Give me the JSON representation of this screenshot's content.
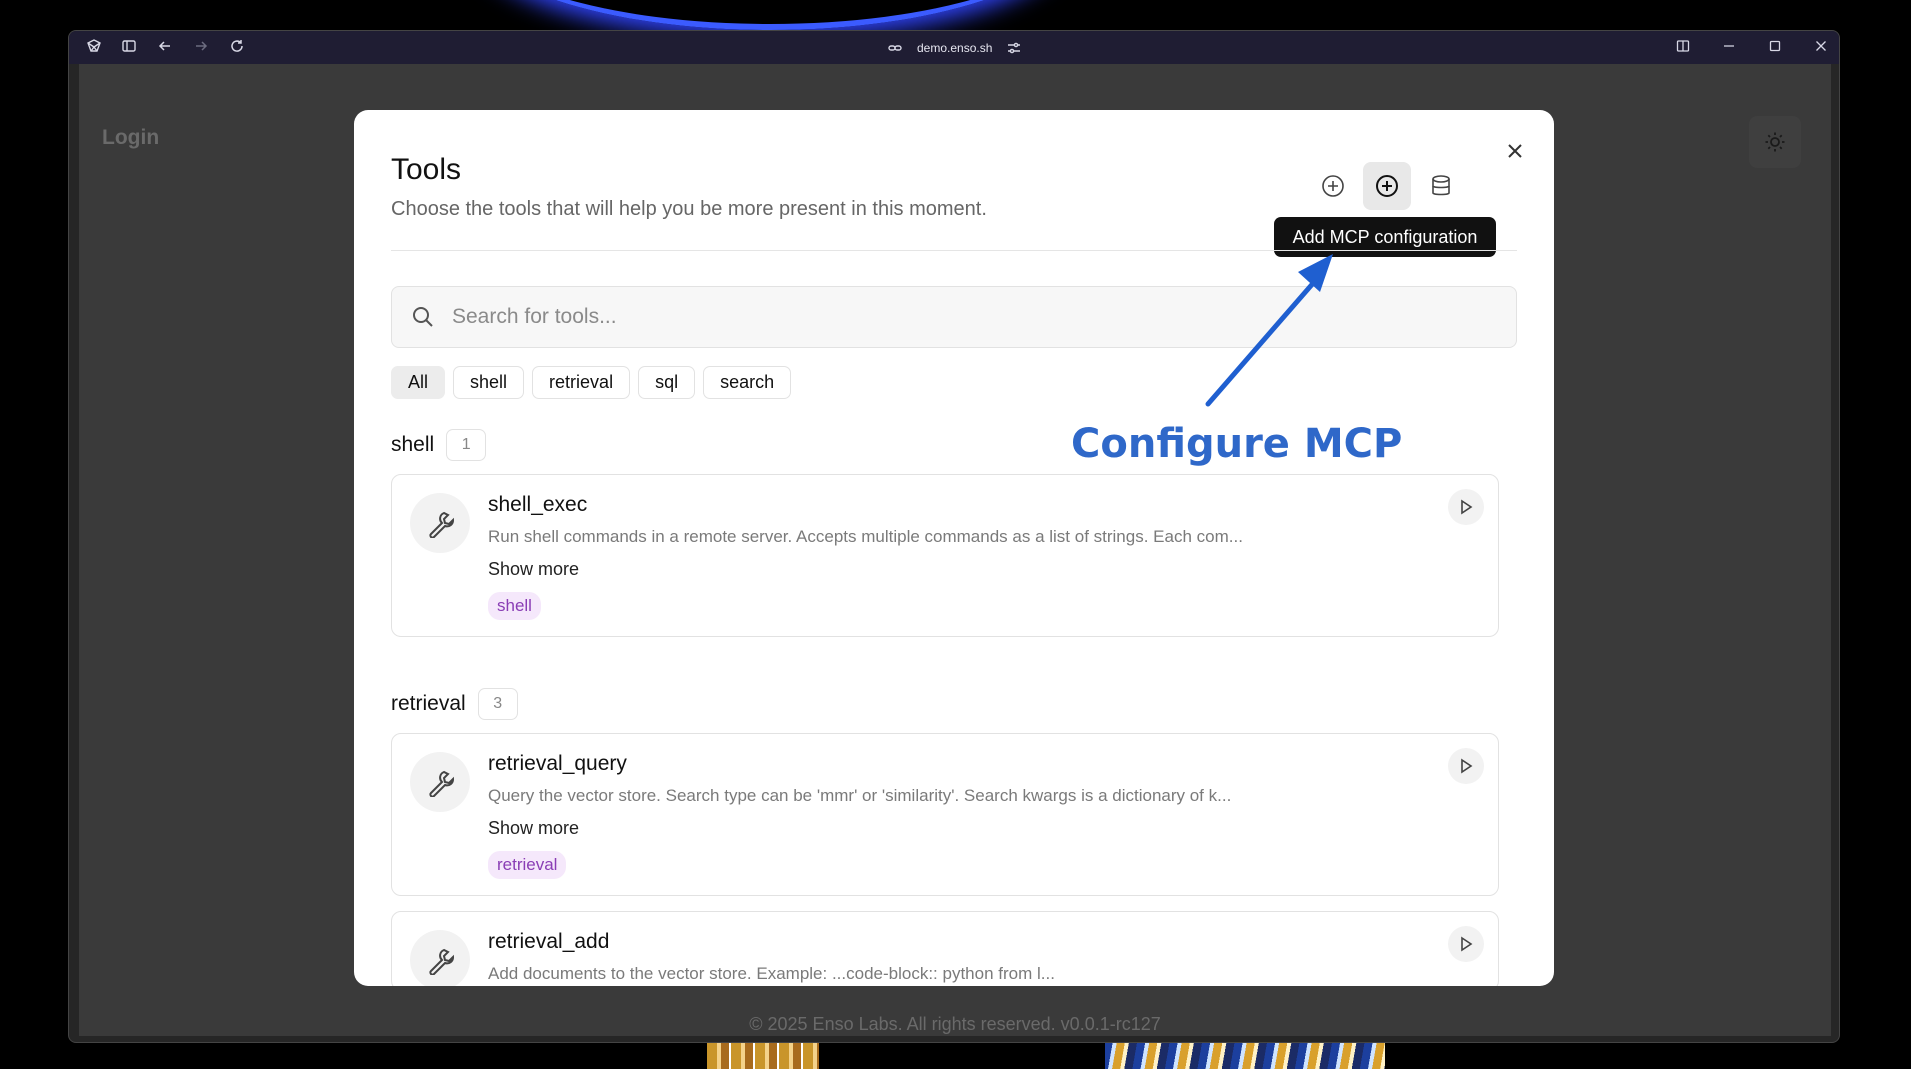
{
  "browser": {
    "url": "demo.enso.sh"
  },
  "app": {
    "login_label": "Login",
    "footer": "© 2025 Enso Labs. All rights reserved. v0.0.1-rc127"
  },
  "modal": {
    "title": "Tools",
    "subtitle": "Choose the tools that will help you be more present in this moment.",
    "tooltip": "Add MCP configuration",
    "search_placeholder": "Search for tools...",
    "filters": [
      "All",
      "shell",
      "retrieval",
      "sql",
      "search"
    ],
    "sections": [
      {
        "name": "shell",
        "count": "1",
        "tools": [
          {
            "name": "shell_exec",
            "description": "Run shell commands in a remote server. Accepts multiple commands as a list of strings. Each com...",
            "more": "Show more",
            "tag": "shell"
          }
        ]
      },
      {
        "name": "retrieval",
        "count": "3",
        "tools": [
          {
            "name": "retrieval_query",
            "description": "Query the vector store. Search type can be 'mmr' or 'similarity'. Search kwargs is a dictionary of k...",
            "more": "Show more",
            "tag": "retrieval"
          },
          {
            "name": "retrieval_add",
            "description": "Add documents to the vector store. Example: ...code-block:: python from l..."
          }
        ]
      }
    ]
  },
  "annotation": {
    "label": "Configure MCP",
    "color": "#2f68c9"
  }
}
